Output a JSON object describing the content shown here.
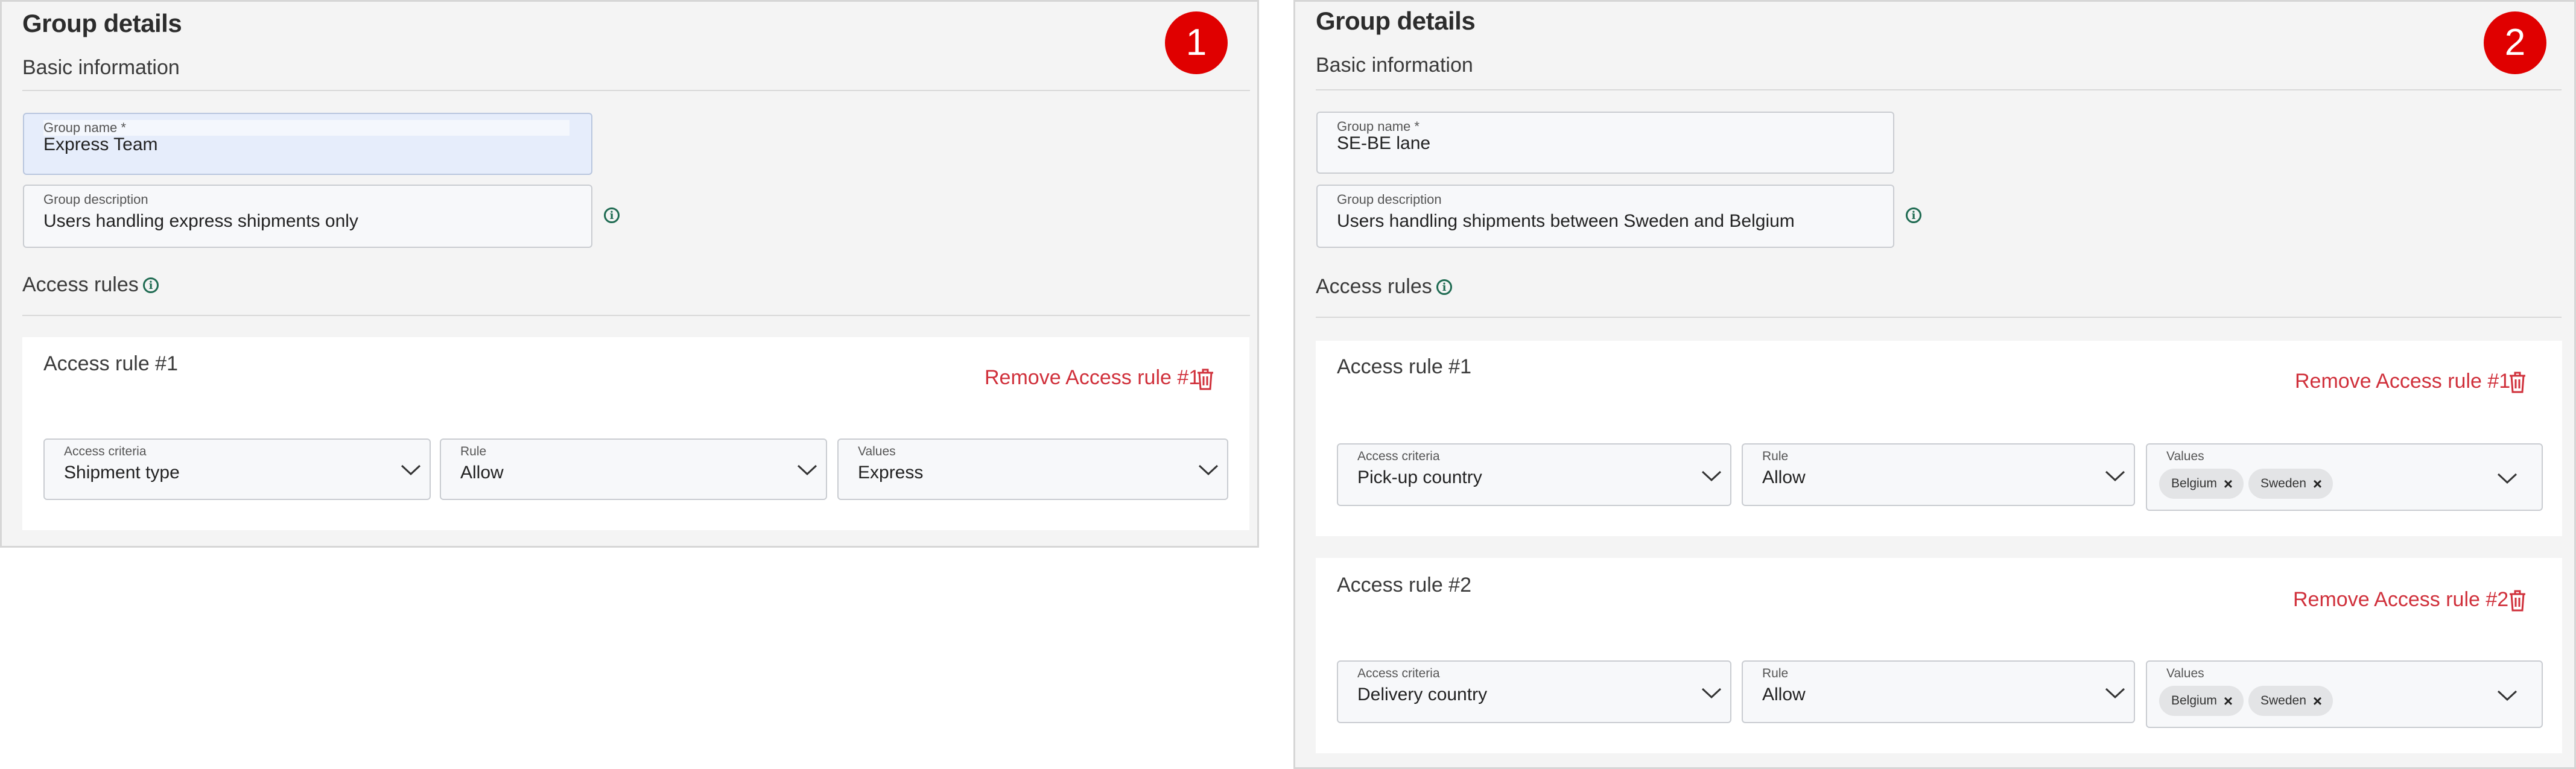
{
  "panels": [
    {
      "badge": "1",
      "title": "Group details",
      "basic_info": "Basic information",
      "group_name_label": "Group name *",
      "group_name_value": "Express Team",
      "group_desc_label": "Group description",
      "group_desc_value": "Users handling express shipments only",
      "access_rules_title": "Access rules",
      "rules": [
        {
          "title": "Access rule #1",
          "remove_label": "Remove Access rule #1",
          "criteria_label": "Access criteria",
          "criteria_value": "Shipment type",
          "rule_label": "Rule",
          "rule_value": "Allow",
          "values_label": "Values",
          "values_value": "Express"
        }
      ]
    },
    {
      "badge": "2",
      "title": "Group details",
      "basic_info": "Basic information",
      "group_name_label": "Group name *",
      "group_name_value": "SE-BE lane",
      "group_desc_label": "Group description",
      "group_desc_value": "Users handling shipments between Sweden and Belgium",
      "access_rules_title": "Access rules",
      "rules": [
        {
          "title": "Access rule #1",
          "remove_label": "Remove Access rule #1",
          "criteria_label": "Access criteria",
          "criteria_value": "Pick-up country",
          "rule_label": "Rule",
          "rule_value": "Allow",
          "values_label": "Values",
          "chips": [
            "Belgium",
            "Sweden"
          ]
        },
        {
          "title": "Access rule #2",
          "remove_label": "Remove Access rule #2",
          "criteria_label": "Access criteria",
          "criteria_value": "Delivery country",
          "rule_label": "Rule",
          "rule_value": "Allow",
          "values_label": "Values",
          "chips": [
            "Belgium",
            "Sweden"
          ]
        }
      ]
    }
  ],
  "icons": {
    "info": "info-circle-icon",
    "trash": "trash-icon",
    "chevron": "chevron-down-icon",
    "chip_remove": "close-icon"
  },
  "colors": {
    "badge": "#e00000",
    "remove_link": "#d0303b",
    "info_icon": "#1f6b52",
    "focused_field": "#e6edfb"
  }
}
